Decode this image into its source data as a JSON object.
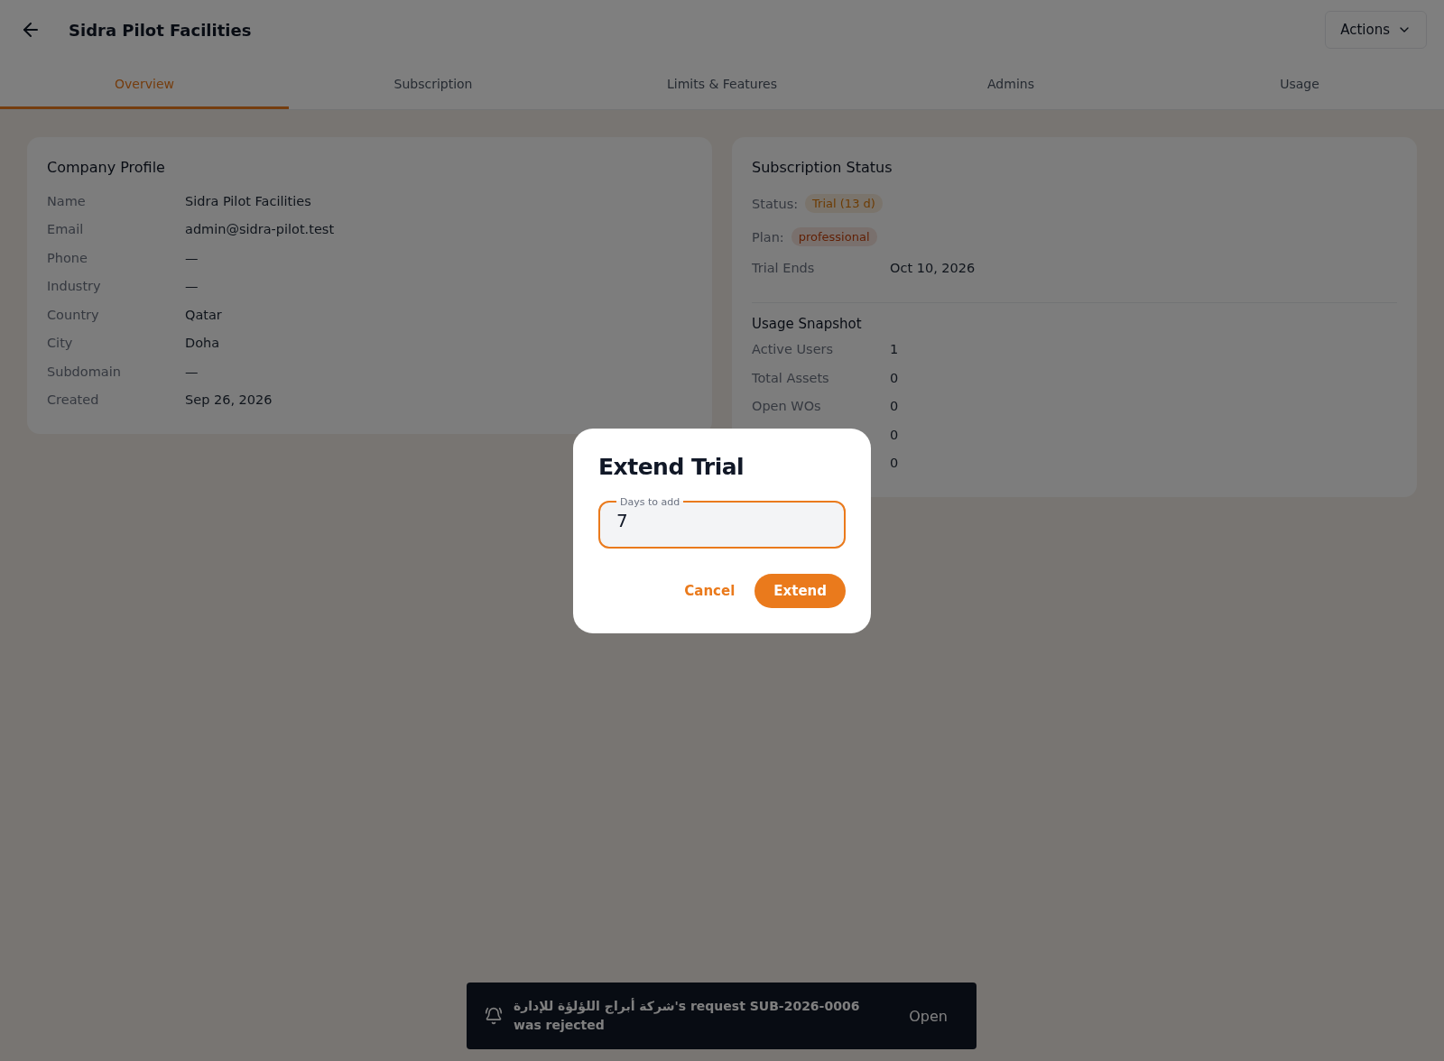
{
  "header": {
    "title": "Sidra Pilot Facilities",
    "actions": "Actions"
  },
  "tabs": [
    {
      "label": "Overview",
      "selected": true
    },
    {
      "label": "Subscription",
      "selected": false
    },
    {
      "label": "Limits & Features",
      "selected": false
    },
    {
      "label": "Admins",
      "selected": false
    },
    {
      "label": "Usage",
      "selected": false
    }
  ],
  "company_profile": {
    "title": "Company Profile",
    "rows": [
      {
        "label": "Name",
        "value": "Sidra Pilot Facilities"
      },
      {
        "label": "Email",
        "value": "admin@sidra-pilot.test"
      },
      {
        "label": "Phone",
        "value": "—"
      },
      {
        "label": "Industry",
        "value": "—"
      },
      {
        "label": "Country",
        "value": "Qatar"
      },
      {
        "label": "City",
        "value": "Doha"
      },
      {
        "label": "Subdomain",
        "value": "—"
      },
      {
        "label": "Created",
        "value": "Sep 26, 2026"
      }
    ]
  },
  "subscription_status": {
    "title": "Subscription Status",
    "badges": [
      {
        "label": "Status:",
        "badge": "Trial (13 d)",
        "kind": "trial"
      },
      {
        "label": "Plan:",
        "badge": "professional",
        "kind": "plan"
      }
    ],
    "rows": [
      {
        "label": "Trial Ends",
        "value": "Oct 10, 2026"
      }
    ],
    "usage_title": "Usage Snapshot",
    "usage": [
      {
        "label": "Active Users",
        "value": "1"
      },
      {
        "label": "Total Assets",
        "value": "0"
      },
      {
        "label": "Open WOs",
        "value": "0"
      },
      {
        "value": "0"
      },
      {
        "value": "0"
      }
    ]
  },
  "dialog": {
    "title": "Extend Trial",
    "field": {
      "label": "Days to add",
      "value": "7"
    },
    "buttons": [
      {
        "label": "Cancel",
        "kind": "text"
      },
      {
        "label": "Extend",
        "kind": "primary"
      }
    ]
  },
  "toast": {
    "message": "شركة أبراج اللؤلؤة للإدارة's request SUB-2026-0006 was rejected",
    "action": "Open"
  }
}
